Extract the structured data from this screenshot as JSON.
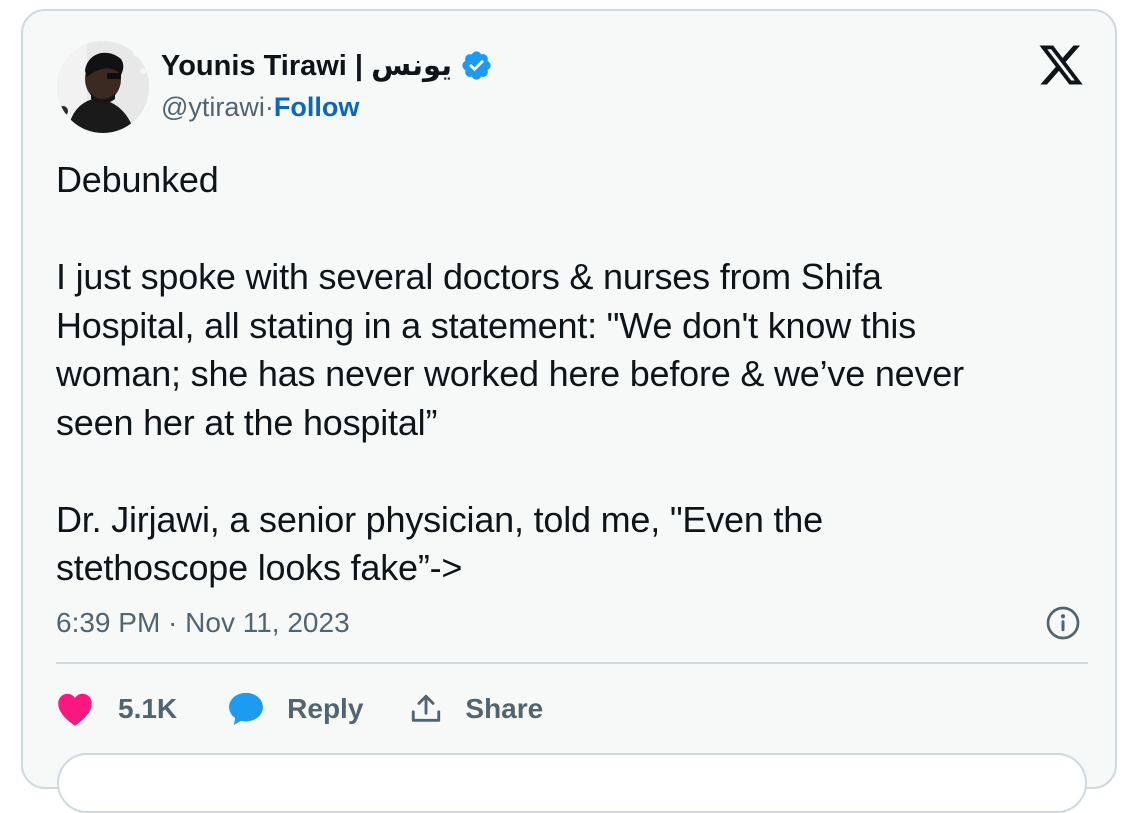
{
  "tweet": {
    "author_name": "Younis Tirawi | يونس",
    "handle": "@ytirawi",
    "separator": " · ",
    "follow_label": "Follow",
    "body": "Debunked\n\nI just spoke with several doctors & nurses from Shifa\nHospital, all stating in a statement: \"We don't know this\nwoman; she has never worked here before & we’ve never\nseen her at the hospital”\n\nDr. Jirjawi, a senior physician, told me, \"Even the\nstethoscope looks fake”->",
    "timestamp": "6:39 PM · Nov 11, 2023"
  },
  "actions": {
    "like_count": "5.1K",
    "reply_label": "Reply",
    "share_label": "Share"
  },
  "icons": {
    "avatar": "avatar-photo",
    "verified": "verified-badge-icon",
    "logo": "x-logo-icon",
    "info": "info-icon",
    "like": "heart-icon",
    "reply": "speech-bubble-icon",
    "share": "share-upload-icon"
  },
  "colors": {
    "text": "#0f1419",
    "secondary": "#536471",
    "follow": "#0a66c2",
    "verified": "#1d9bf0",
    "like": "#f91880",
    "reply": "#1d9bf0",
    "card_background": "#f7f9f9",
    "border": "#cfd9de"
  }
}
